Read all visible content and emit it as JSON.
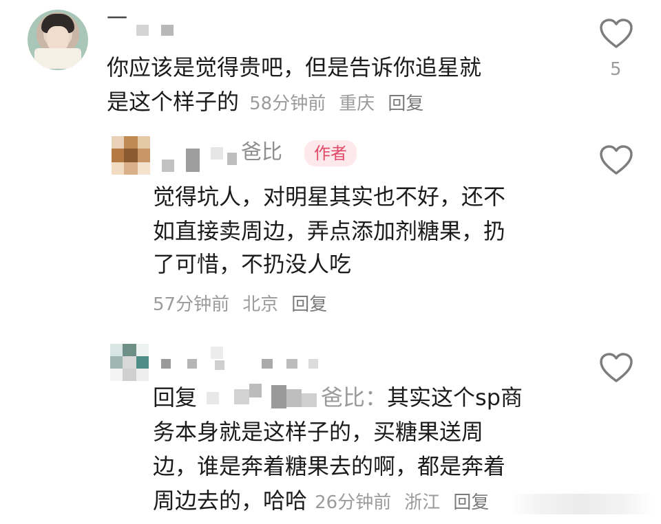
{
  "comments": [
    {
      "username": "一",
      "text_line1": "你应该是觉得贵吧，但是告诉你追星就",
      "text_line2": "是这个样子的",
      "time": "58分钟前",
      "location": "重庆",
      "reply": "回复",
      "likes": "5"
    },
    {
      "username_suffix": "爸比",
      "author_badge": "作者",
      "text_line1": "觉得坑人，对明星其实也不好，还不",
      "text_line2": "如直接卖周边，弄点添加剂糖果，扔",
      "text_line3": "了可惜，不扔没人吃",
      "time": "57分钟前",
      "location": "北京",
      "reply": "回复"
    },
    {
      "reply_prefix": "回复",
      "reply_target_suffix": "爸比：",
      "text_line1_rest": "其实这个sp商",
      "text_line2": "务本身就是这样子的，买糖果送周",
      "text_line3": "边，谁是奔着糖果去的啊，都是奔着",
      "text_line4": "周边去的，哈哈",
      "time": "26分钟前",
      "location": "浙江",
      "reply": "回复"
    }
  ],
  "icons": {
    "like": "heart-outline-icon"
  },
  "colors": {
    "text": "#1b1b1b",
    "meta": "#9b9b9b",
    "badge_bg": "#fde8ec",
    "badge_text": "#e04a66"
  }
}
